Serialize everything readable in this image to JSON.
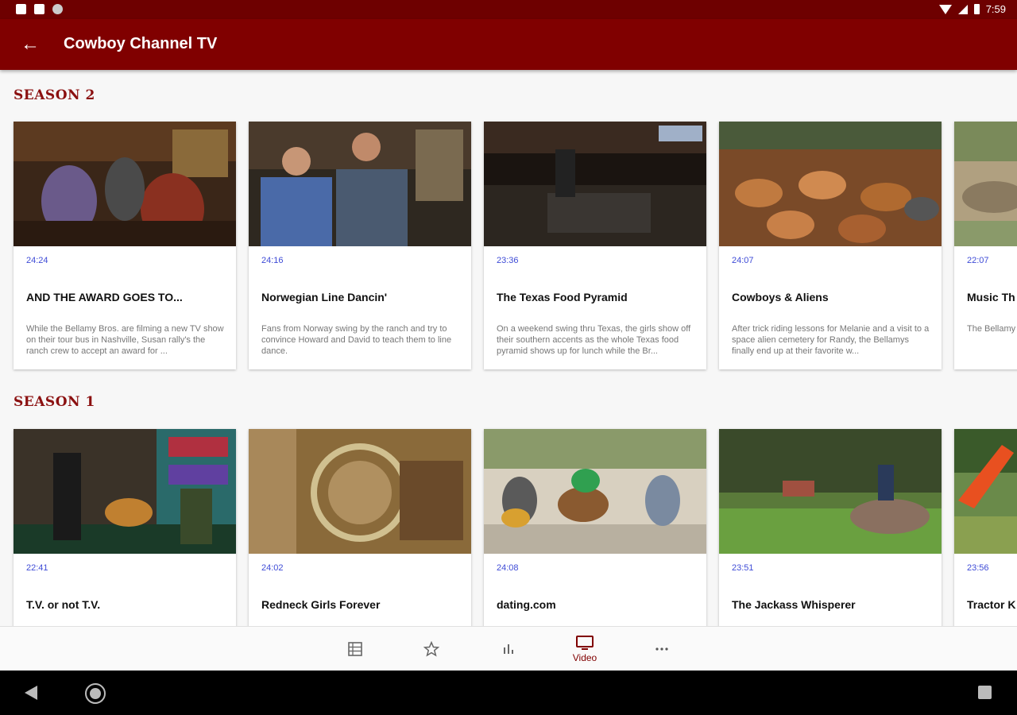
{
  "status_bar": {
    "time": "7:59"
  },
  "app_bar": {
    "title": "Cowboy Channel TV"
  },
  "seasons": [
    {
      "title": "SEASON 2",
      "episodes": [
        {
          "duration": "24:24",
          "title": "AND THE AWARD GOES TO...",
          "description": "While the Bellamy Bros. are filming a new TV show on their tour bus in Nashville, Susan rally's the ranch crew to accept an award for ..."
        },
        {
          "duration": "24:16",
          "title": "Norwegian Line Dancin'",
          "description": "Fans from Norway swing by the ranch and try to convince Howard and David to teach them to line dance."
        },
        {
          "duration": "23:36",
          "title": "The Texas Food Pyramid",
          "description": "On a weekend swing thru Texas, the girls show off their southern accents as the whole Texas food pyramid shows up for lunch while the Br..."
        },
        {
          "duration": "24:07",
          "title": "Cowboys & Aliens",
          "description": "After trick riding lessons for Melanie and a visit to a space alien cemetery for Randy, the Bellamys finally end up at their favorite w..."
        },
        {
          "duration": "22:07",
          "title": "Music Th",
          "description": "The Bellamy doctors, pers Hospital in T"
        }
      ]
    },
    {
      "title": "SEASON 1",
      "episodes": [
        {
          "duration": "22:41",
          "title": "T.V. or not T.V.",
          "description": ""
        },
        {
          "duration": "24:02",
          "title": "Redneck Girls Forever",
          "description": ""
        },
        {
          "duration": "24:08",
          "title": "dating.com",
          "description": ""
        },
        {
          "duration": "23:51",
          "title": "The Jackass Whisperer",
          "description": ""
        },
        {
          "duration": "23:56",
          "title": "Tractor K",
          "description": ""
        }
      ]
    }
  ],
  "bottom_nav": {
    "items": [
      {
        "icon": "grid-icon",
        "label": ""
      },
      {
        "icon": "star-icon",
        "label": ""
      },
      {
        "icon": "chart-icon",
        "label": ""
      },
      {
        "icon": "tv-icon",
        "label": "Video",
        "active": true
      },
      {
        "icon": "more-icon",
        "label": ""
      }
    ]
  },
  "colors": {
    "status_bar": "#6e0000",
    "app_bar": "#800000",
    "season_title": "#8b1010",
    "duration": "#3e4bd6"
  }
}
